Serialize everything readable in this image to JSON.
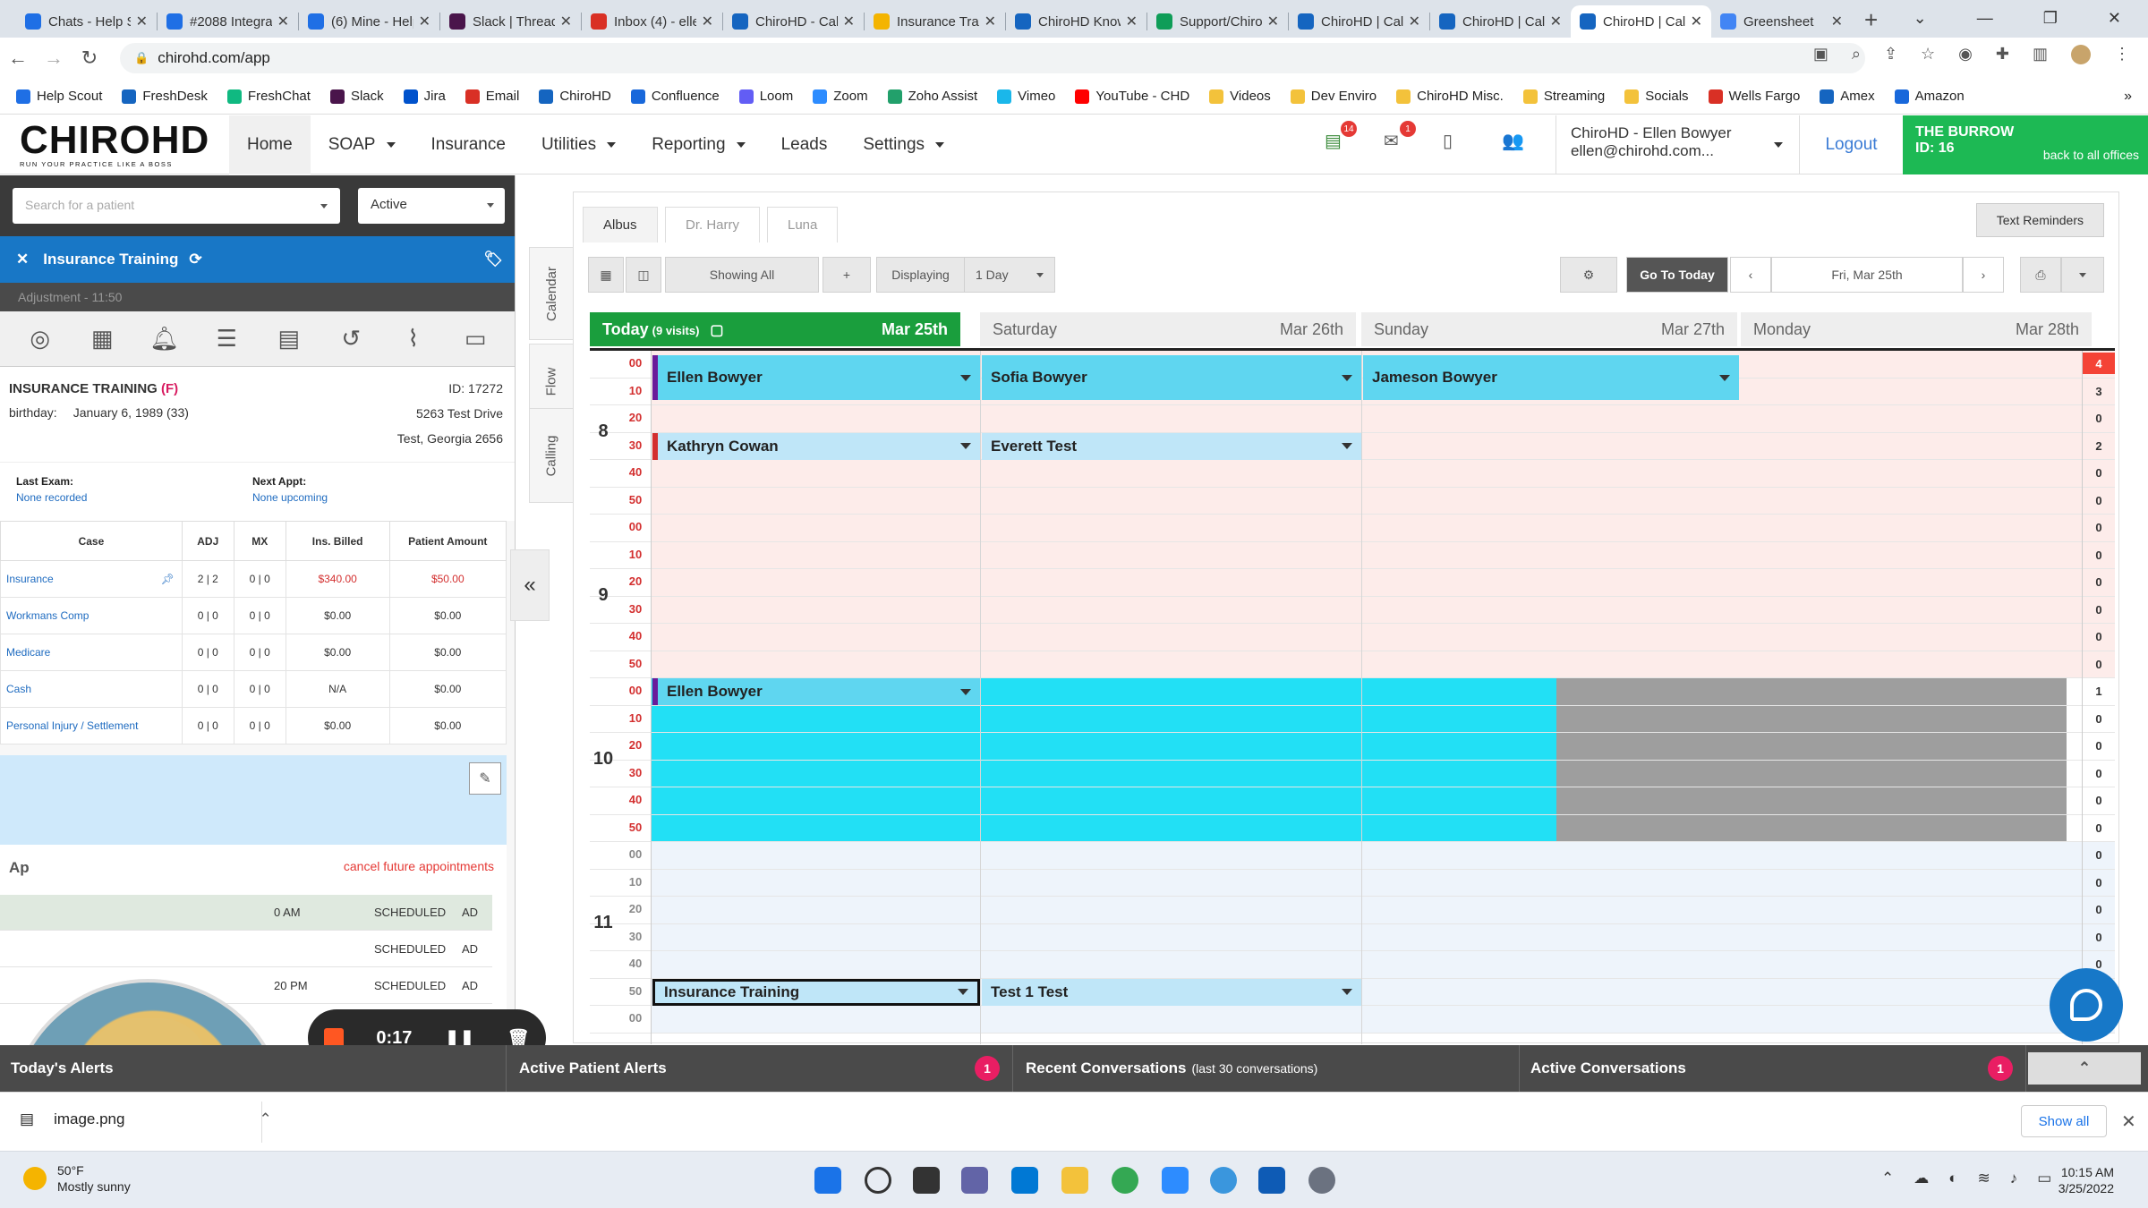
{
  "browser": {
    "tabs": [
      {
        "title": "Chats - Help Scout",
        "color": "#1f6fe5"
      },
      {
        "title": "#2088 Integration",
        "color": "#1f6fe5"
      },
      {
        "title": "(6) Mine - Help",
        "color": "#1f6fe5"
      },
      {
        "title": "Slack | Threads",
        "color": "#4a154b"
      },
      {
        "title": "Inbox (4) - ellen",
        "color": "#d93025"
      },
      {
        "title": "ChiroHD - Calendar",
        "color": "#1565c0"
      },
      {
        "title": "Insurance Training",
        "color": "#f4b400"
      },
      {
        "title": "ChiroHD Knowledge",
        "color": "#1565c0"
      },
      {
        "title": "Support/ChiroHD",
        "color": "#0f9d58"
      },
      {
        "title": "ChiroHD | Calendar",
        "color": "#1565c0"
      },
      {
        "title": "ChiroHD | Calendar",
        "color": "#1565c0"
      },
      {
        "title": "ChiroHD | Calendar",
        "color": "#1565c0"
      },
      {
        "title": "Greensheet",
        "color": "#4285f4"
      }
    ],
    "active_tab_index": 11,
    "url": "chirohd.com/app",
    "bookmarks": [
      "Help Scout",
      "FreshDesk",
      "FreshChat",
      "Slack",
      "Jira",
      "Email",
      "ChiroHD",
      "Confluence",
      "Loom",
      "Zoom",
      "Zoho Assist",
      "Vimeo",
      "YouTube - CHD",
      "Videos",
      "Dev Enviro",
      "ChiroHD Misc.",
      "Streaming",
      "Socials",
      "Wells Fargo",
      "Amex",
      "Amazon"
    ]
  },
  "app": {
    "logo": "CHIROHD",
    "logo_tagline": "RUN YOUR PRACTICE LIKE A BOSS",
    "nav": [
      "Home",
      "SOAP",
      "Insurance",
      "Utilities",
      "Reporting",
      "Leads",
      "Settings"
    ],
    "nav_dropdowns": [
      false,
      true,
      false,
      true,
      true,
      false,
      true
    ],
    "header_badges": {
      "messages": "14",
      "mail": "1"
    },
    "user_name": "ChiroHD - Ellen Bowyer",
    "user_email": "ellen@chirohd.com...",
    "logout": "Logout",
    "office_name": "THE BURROW",
    "office_id": "ID: 16",
    "office_back": "back to all offices",
    "accent_green": "#1db954",
    "accent_blue": "#1877c6"
  },
  "patient_panel": {
    "search_placeholder": "Search for a patient",
    "status_filter": "Active",
    "patient_name": "Insurance Training",
    "adjustment": "Adjustment - 11:50",
    "header_name": "INSURANCE TRAINING",
    "header_sex": "(F)",
    "id": "ID: 17272",
    "birthday_label": "birthday:",
    "birthday": "January 6, 1989 (33)",
    "address1": "5263 Test Drive",
    "address2": "Test, Georgia 2656",
    "last_exam_label": "Last Exam:",
    "last_exam": "None recorded",
    "next_appt_label": "Next Appt:",
    "next_appt": "None upcoming",
    "table_headers": [
      "Case",
      "ADJ",
      "MX",
      "Ins. Billed",
      "Patient Amount"
    ],
    "cases": [
      {
        "case": "Insurance",
        "adj": "2 | 2",
        "mx": "0 | 0",
        "billed": "$340.00",
        "amount": "$50.00",
        "red": true
      },
      {
        "case": "Workmans Comp",
        "adj": "0 | 0",
        "mx": "0 | 0",
        "billed": "$0.00",
        "amount": "$0.00",
        "red": false
      },
      {
        "case": "Medicare",
        "adj": "0 | 0",
        "mx": "0 | 0",
        "billed": "$0.00",
        "amount": "$0.00",
        "red": false
      },
      {
        "case": "Cash",
        "adj": "0 | 0",
        "mx": "0 | 0",
        "billed": "N/A",
        "amount": "$0.00",
        "red": false
      },
      {
        "case": "Personal Injury / Settlement",
        "adj": "0 | 0",
        "mx": "0 | 0",
        "billed": "$0.00",
        "amount": "$0.00",
        "red": false
      }
    ],
    "appts_title": "Ap",
    "cancel_future": "cancel future appointments",
    "appointments": [
      {
        "time": "0 AM",
        "status": "SCHEDULED",
        "type": "AD"
      },
      {
        "time": "",
        "status": "SCHEDULED",
        "type": "AD"
      },
      {
        "time": "20 PM",
        "status": "SCHEDULED",
        "type": "AD"
      }
    ],
    "recording_time": "0:17"
  },
  "side_tabs": [
    "Calendar",
    "Flow",
    "Calling"
  ],
  "calendar": {
    "doctor_tabs": [
      "Albus",
      "Dr. Harry",
      "Luna"
    ],
    "text_reminders": "Text Reminders",
    "showing": "Showing All",
    "displaying_label": "Displaying",
    "displaying_value": "1 Day",
    "go_to_today": "Go To Today",
    "current_date": "Fri, Mar 25th",
    "days": [
      {
        "name": "Today",
        "extra": "(9 visits)",
        "date": "Mar 25th",
        "today": true
      },
      {
        "name": "Saturday",
        "extra": "",
        "date": "Mar 26th",
        "today": false
      },
      {
        "name": "Sunday",
        "extra": "",
        "date": "Mar 27th",
        "today": false
      },
      {
        "name": "Monday",
        "extra": "",
        "date": "Mar 28th",
        "today": false
      }
    ],
    "hours": [
      "8",
      "9",
      "10",
      "11"
    ],
    "minutes": [
      "00",
      "10",
      "20",
      "30",
      "40",
      "50"
    ],
    "row_counts": [
      "4",
      "3",
      "0",
      "2",
      "0",
      "0",
      "0",
      "0",
      "0",
      "0",
      "0",
      "0",
      "1",
      "0",
      "0",
      "0",
      "0",
      "0",
      "0",
      "0",
      "0",
      "0",
      "0",
      "0",
      "0"
    ],
    "appointments": [
      {
        "name": "Ellen Bowyer",
        "column": 0,
        "row": 0,
        "flag": "#6a1b9a",
        "color": "#5fd6f0"
      },
      {
        "name": "Sofia Bowyer",
        "column": 1,
        "row": 0,
        "flag": "",
        "color": "#5fd6f0"
      },
      {
        "name": "Jameson Bowyer",
        "column": 2,
        "row": 0,
        "flag": "",
        "color": "#5fd6f0"
      },
      {
        "name": "Kathryn Cowan",
        "column": 0,
        "row": 3,
        "flag": "#d32f2f",
        "color": "#bfe6f8"
      },
      {
        "name": "Everett Test",
        "column": 1,
        "row": 3,
        "flag": "",
        "color": "#bfe6f8"
      },
      {
        "name": "Ellen Bowyer",
        "column": 0,
        "row": 12,
        "flag": "#6a1b9a",
        "color": "#5fd6f0"
      },
      {
        "name": "Insurance Training",
        "column": 0,
        "row": 23,
        "flag": "",
        "color": "#bfe6f8",
        "selected": true
      },
      {
        "name": "Test 1 Test",
        "column": 1,
        "row": 23,
        "flag": "",
        "color": "#bfe6f8"
      }
    ]
  },
  "bottom": {
    "todays_alerts": "Today's Alerts",
    "active_patient_alerts": "Active Patient Alerts",
    "active_patient_alerts_count": "1",
    "recent_conversations": "Recent Conversations",
    "recent_conversations_sub": "(last 30 conversations)",
    "active_conversations": "Active Conversations",
    "active_conversations_count": "1"
  },
  "downloads": {
    "file": "image.png",
    "show_all": "Show all"
  },
  "taskbar": {
    "temp": "50°F",
    "weather": "Mostly sunny",
    "time": "10:15 AM",
    "date": "3/25/2022"
  }
}
